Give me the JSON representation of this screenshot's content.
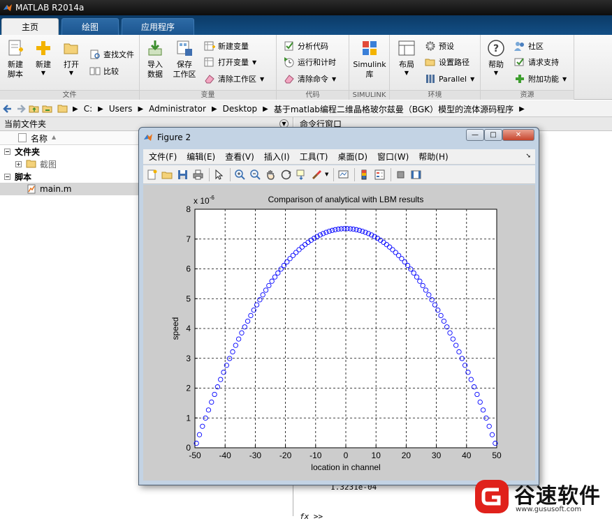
{
  "app": {
    "title": "MATLAB R2014a"
  },
  "tabs": [
    {
      "label": "主页",
      "active": true
    },
    {
      "label": "绘图",
      "active": false
    },
    {
      "label": "应用程序",
      "active": false
    }
  ],
  "ribbon": {
    "file": {
      "label": "文件",
      "new_script": "新建\n脚本",
      "new": "新建",
      "open": "打开",
      "find_files": "查找文件",
      "compare": "比较"
    },
    "variable": {
      "label": "变量",
      "import": "导入\n数据",
      "save_workspace": "保存\n工作区",
      "new_variable": "新建变量",
      "open_variable": "打开变量",
      "clear_workspace": "清除工作区"
    },
    "code": {
      "label": "代码",
      "analyze": "分析代码",
      "run_time": "运行和计时",
      "clear_commands": "清除命令"
    },
    "simulink": {
      "label": "SIMULINK",
      "btn": "Simulink\n库"
    },
    "environment": {
      "label": "环境",
      "layout": "布局",
      "preferences": "预设",
      "set_path": "设置路径",
      "parallel": "Parallel"
    },
    "resources": {
      "label": "资源",
      "help": "帮助",
      "community": "社区",
      "support": "请求支持",
      "addons": "附加功能"
    }
  },
  "address": {
    "crumbs": [
      "C:",
      "Users",
      "Administrator",
      "Desktop",
      "基于matlab编程二维晶格玻尔兹曼（BGK）模型的流体源码程序"
    ]
  },
  "left_panel": {
    "title": "当前文件夹",
    "column_name": "名称",
    "sort_indicator": "▲",
    "group_folder": "文件夹",
    "folder_item": "截图",
    "group_script": "脚本",
    "script_item": "main.m"
  },
  "command_window": {
    "title": "命令行窗口",
    "output": "1.3231e-04",
    "prompt": "fx >>"
  },
  "figure": {
    "title": "Figure 2",
    "menu": [
      "文件(F)",
      "编辑(E)",
      "查看(V)",
      "插入(I)",
      "工具(T)",
      "桌面(D)",
      "窗口(W)",
      "帮助(H)"
    ],
    "pin": "➘",
    "controls": {
      "minimize": "—",
      "maximize": "□",
      "close": "✕"
    }
  },
  "chart_data": {
    "type": "scatter",
    "title": "Comparison of analytical with LBM results",
    "xlabel": "location in channel",
    "ylabel": "speed",
    "y_exponent": "x 10",
    "y_exponent_power": "-6",
    "xlim": [
      -50,
      50
    ],
    "ylim": [
      0,
      8
    ],
    "xticks": [
      -50,
      -40,
      -30,
      -20,
      -10,
      0,
      10,
      20,
      30,
      40,
      50
    ],
    "yticks": [
      0,
      1,
      2,
      3,
      4,
      5,
      6,
      7,
      8
    ],
    "grid": true,
    "grid_style": "dashed",
    "marker": "circle-open",
    "marker_color": "#0000ff",
    "series": [
      {
        "x_start": -49.5,
        "x_step": 1,
        "count": 100,
        "y_peak": 7.35,
        "y_edge": 0.15,
        "shape": "parabola"
      }
    ]
  },
  "colors": {
    "titlebar": "#1a1a1a",
    "ribbon_tab": "#134f86",
    "figure_frame": "#c3d3e4",
    "plot_marker": "#0000ff",
    "logo_red": "#e0211b"
  },
  "watermark": {
    "text": "谷速软件",
    "url": "www.gususoft.com"
  }
}
